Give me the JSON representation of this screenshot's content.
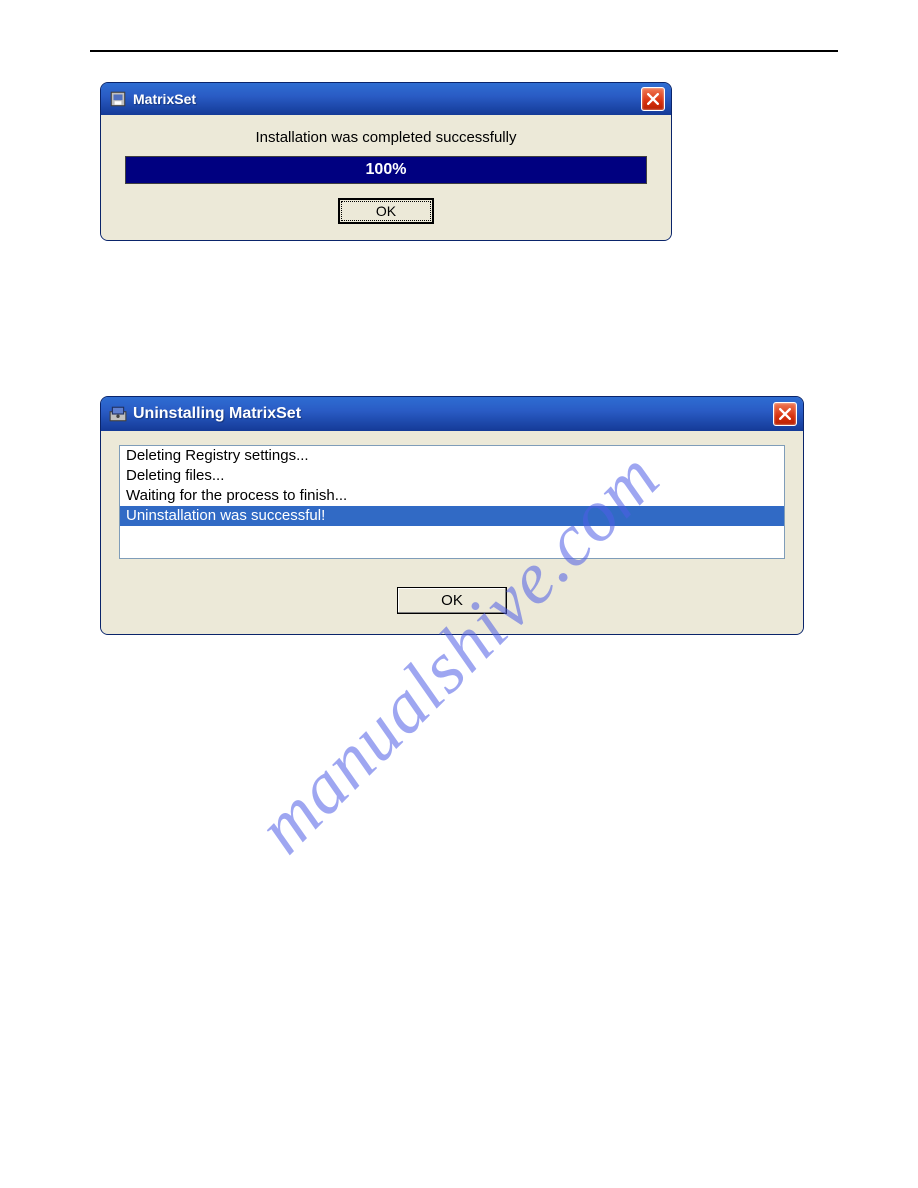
{
  "watermark": "manualshive.com",
  "dialog1": {
    "title": "MatrixSet",
    "status": "Installation was completed successfully",
    "progress_pct": "100%",
    "ok_label": "OK"
  },
  "dialog2": {
    "title": "Uninstalling MatrixSet",
    "log": [
      "Deleting Registry settings...",
      "Deleting files...",
      "Waiting for the process to finish...",
      "Uninstallation was successful!"
    ],
    "selected_index": 3,
    "ok_label": "OK"
  }
}
